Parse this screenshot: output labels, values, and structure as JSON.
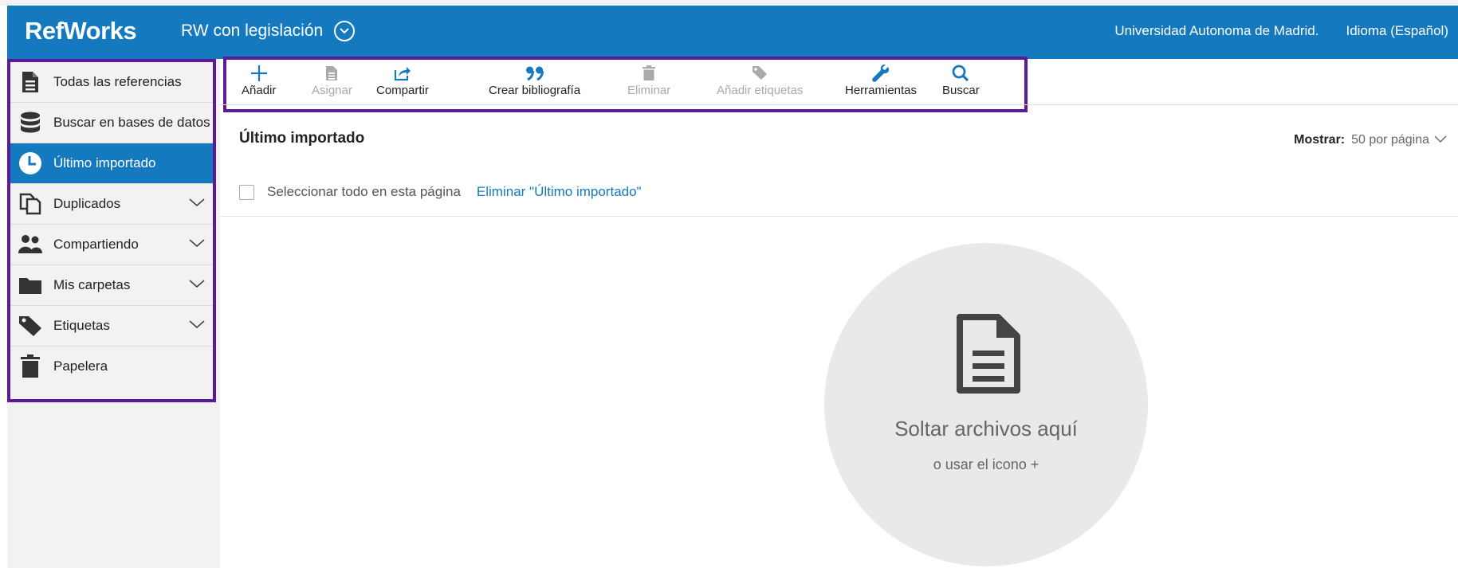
{
  "header": {
    "logo": "RefWorks",
    "project_name": "RW con legislación",
    "institution": "Universidad Autonoma de Madrid.",
    "language": "Idioma (Español)"
  },
  "sidebar": {
    "items": [
      {
        "label": "Todas las referencias",
        "icon": "document-icon"
      },
      {
        "label": "Buscar en bases de datos",
        "icon": "database-icon"
      },
      {
        "label": "Último importado",
        "icon": "clock-icon",
        "active": true
      },
      {
        "label": "Duplicados",
        "icon": "duplicates-icon",
        "expandable": true
      },
      {
        "label": "Compartiendo",
        "icon": "users-icon",
        "expandable": true
      },
      {
        "label": "Mis carpetas",
        "icon": "folder-icon",
        "expandable": true
      },
      {
        "label": "Etiquetas",
        "icon": "tag-icon",
        "expandable": true
      },
      {
        "label": "Papelera",
        "icon": "trash-icon"
      }
    ]
  },
  "toolbar": {
    "add": "Añadir",
    "assign": "Asignar",
    "share": "Compartir",
    "bibliography": "Crear bibliografía",
    "delete": "Eliminar",
    "add_tags": "Añadir etiquetas",
    "tools": "Herramientas",
    "search": "Buscar"
  },
  "content": {
    "title": "Último importado",
    "show_label": "Mostrar:",
    "show_value": "50 por página",
    "select_all": "Seleccionar todo en esta página",
    "delete_link": "Eliminar \"Último importado\"",
    "drop_main": "Soltar archivos aquí",
    "drop_sub": "o usar el icono +"
  },
  "colors": {
    "brand": "#1479bf",
    "highlight_border": "#5b1a99",
    "sidebar_bg": "#f2f2f2"
  }
}
